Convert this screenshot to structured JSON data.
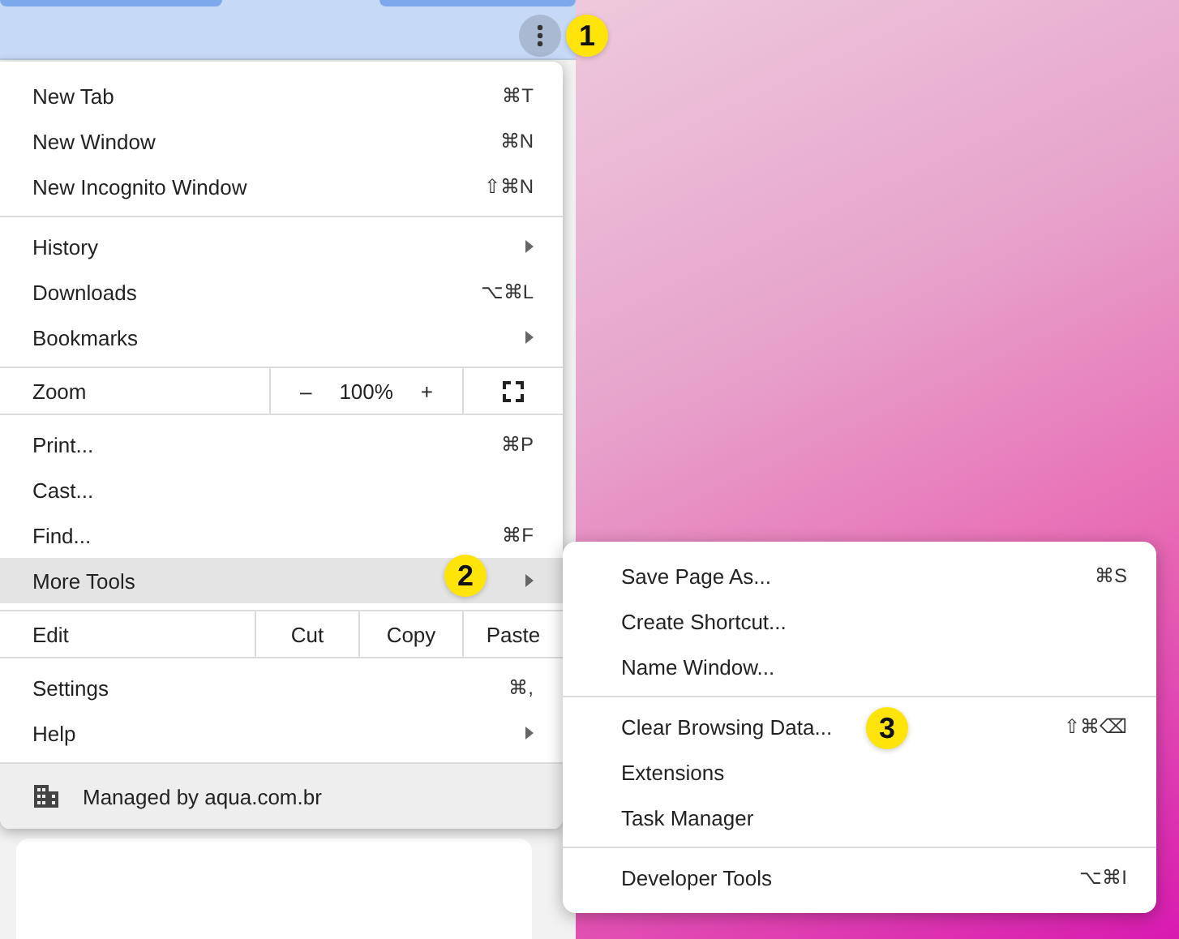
{
  "menu": {
    "sections": [
      {
        "items": [
          {
            "kind": "item",
            "label": "New Tab",
            "shortcut": "⌘T",
            "submenu": false,
            "highlighted": false
          },
          {
            "kind": "item",
            "label": "New Window",
            "shortcut": "⌘N",
            "submenu": false,
            "highlighted": false
          },
          {
            "kind": "item",
            "label": "New Incognito Window",
            "shortcut": "⇧⌘N",
            "submenu": false,
            "highlighted": false
          }
        ]
      },
      {
        "items": [
          {
            "kind": "item",
            "label": "History",
            "submenu": true,
            "highlighted": false
          },
          {
            "kind": "item",
            "label": "Downloads",
            "shortcut": "⌥⌘L",
            "submenu": false,
            "highlighted": false
          },
          {
            "kind": "item",
            "label": "Bookmarks",
            "submenu": true,
            "highlighted": false
          }
        ]
      },
      {
        "items": [
          {
            "kind": "zoom",
            "label": "Zoom",
            "minus": "–",
            "value": "100%",
            "plus": "+"
          }
        ]
      },
      {
        "items": [
          {
            "kind": "item",
            "label": "Print...",
            "shortcut": "⌘P",
            "submenu": false,
            "highlighted": false
          },
          {
            "kind": "item",
            "label": "Cast...",
            "submenu": false,
            "highlighted": false
          },
          {
            "kind": "item",
            "label": "Find...",
            "shortcut": "⌘F",
            "submenu": false,
            "highlighted": false
          },
          {
            "kind": "item",
            "label": "More Tools",
            "submenu": true,
            "highlighted": true
          }
        ]
      },
      {
        "items": [
          {
            "kind": "edit",
            "label": "Edit",
            "buttons": [
              "Cut",
              "Copy",
              "Paste"
            ]
          }
        ]
      },
      {
        "items": [
          {
            "kind": "item",
            "label": "Settings",
            "shortcut": "⌘,",
            "submenu": false,
            "highlighted": false
          },
          {
            "kind": "item",
            "label": "Help",
            "submenu": true,
            "highlighted": false
          }
        ]
      },
      {
        "items": [
          {
            "kind": "footer",
            "label": "Managed by aqua.com.br"
          }
        ]
      }
    ]
  },
  "submenu": {
    "sections": [
      {
        "items": [
          {
            "kind": "item",
            "label": "Save Page As...",
            "shortcut": "⌘S",
            "submenu": false,
            "highlighted": false
          },
          {
            "kind": "item",
            "label": "Create Shortcut...",
            "submenu": false,
            "highlighted": false
          },
          {
            "kind": "item",
            "label": "Name Window...",
            "submenu": false,
            "highlighted": false
          }
        ]
      },
      {
        "items": [
          {
            "kind": "item",
            "label": "Clear Browsing Data...",
            "shortcut": "⇧⌘⌫",
            "submenu": false,
            "highlighted": false
          },
          {
            "kind": "item",
            "label": "Extensions",
            "submenu": false,
            "highlighted": false
          },
          {
            "kind": "item",
            "label": "Task Manager",
            "submenu": false,
            "highlighted": false
          }
        ]
      },
      {
        "items": [
          {
            "kind": "item",
            "label": "Developer Tools",
            "shortcut": "⌥⌘I",
            "submenu": false,
            "highlighted": false
          }
        ]
      }
    ]
  },
  "badges": [
    {
      "number": "1"
    },
    {
      "number": "2"
    },
    {
      "number": "3"
    }
  ]
}
